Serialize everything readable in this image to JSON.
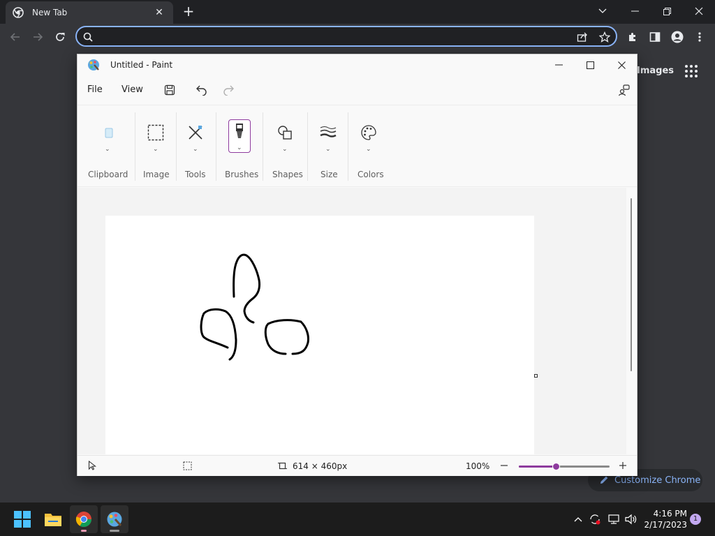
{
  "browser": {
    "tab_title": "New Tab",
    "tab_close_glyph": "✕",
    "new_tab_glyph": "+",
    "omnibox_value": "",
    "omnibox_placeholder": "",
    "ntp_images_label": "Images",
    "customize_label": "Customize Chrome",
    "accent": "#8ab4f8",
    "icons": [
      "chrome-favicon",
      "back-icon",
      "forward-icon",
      "reload-icon",
      "search-icon",
      "share-icon",
      "star-icon",
      "extensions-icon",
      "side-panel-icon",
      "profile-icon",
      "menu-icon",
      "apps-grid-icon",
      "pencil-icon"
    ]
  },
  "paint": {
    "title": "Untitled - Paint",
    "menu": {
      "file": "File",
      "view": "View"
    },
    "ribbon_groups": [
      "Clipboard",
      "Image",
      "Tools",
      "Brushes",
      "Shapes",
      "Size",
      "Colors"
    ],
    "status": {
      "canvas_size": "614 × 460px",
      "zoom": "100%",
      "zoom_fraction": 0.41
    },
    "accent": "#8e3b9e"
  },
  "taskbar": {
    "time": "4:16 PM",
    "date": "2/17/2023",
    "notification_count": "1",
    "apps": [
      "start",
      "file-explorer",
      "chrome",
      "paint"
    ]
  }
}
